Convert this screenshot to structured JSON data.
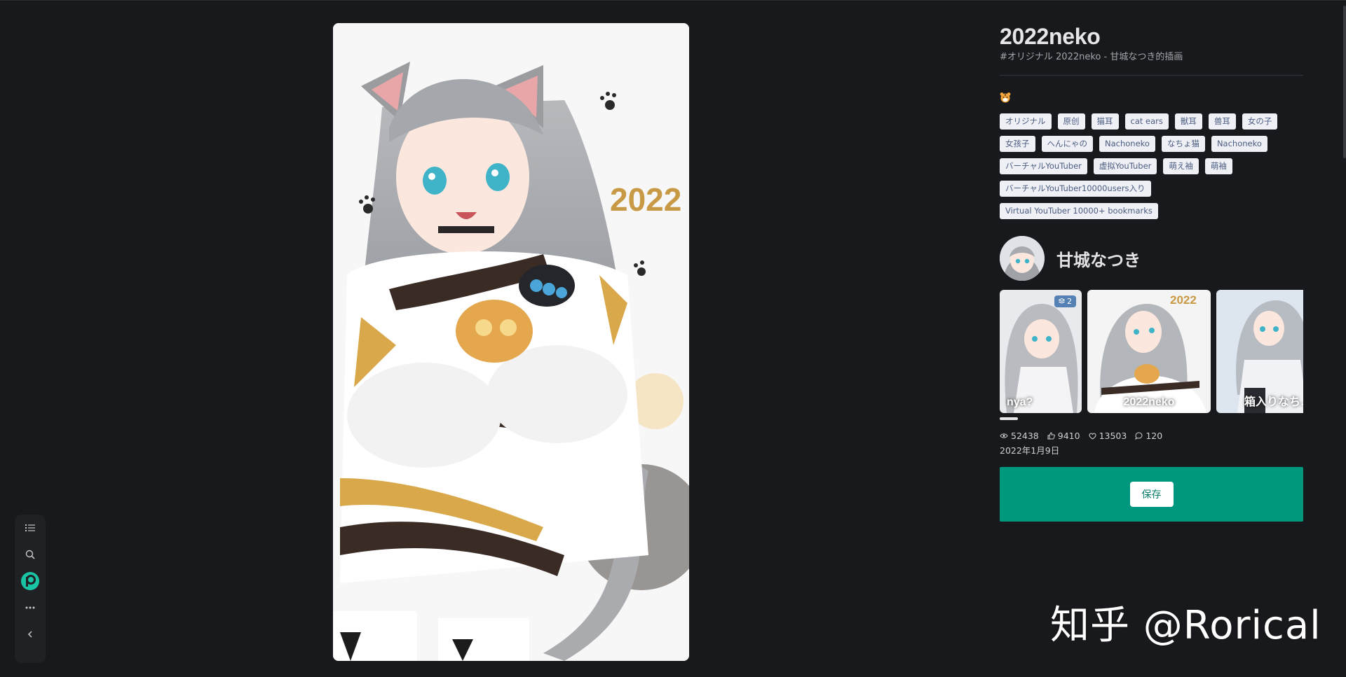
{
  "artwork": {
    "title": "2022neko",
    "subtitle": "#オリジナル 2022neko - 甘城なつき的插画",
    "image_text": "2022"
  },
  "tags": [
    "オリジナル",
    "原创",
    "猫耳",
    "cat ears",
    "獣耳",
    "兽耳",
    "女の子",
    "女孩子",
    "へんにゃの",
    "Nachoneko",
    "なちょ猫",
    "Nachoneko",
    "バーチャルYouTuber",
    "虚拟YouTuber",
    "萌え袖",
    "萌袖",
    "バーチャルYouTuber10000users入り",
    "Virtual YouTuber 10000+ bookmarks"
  ],
  "artist": {
    "name": "甘城なつき"
  },
  "thumbnails": [
    {
      "caption": "nya?",
      "badge": "2"
    },
    {
      "caption": "2022neko",
      "badge": ""
    },
    {
      "caption": "箱入りなち…",
      "badge": ""
    }
  ],
  "stats": {
    "views": "52438",
    "likes": "9410",
    "bookmarks": "13503",
    "comments": "120",
    "date": "2022年1月9日"
  },
  "actions": {
    "save_label": "保存"
  },
  "watermark": "知乎 @Rorical",
  "colors": {
    "background": "#18191c",
    "accent": "#00977f",
    "tag_bg": "#eef0f6",
    "tag_text": "#4b5c80"
  },
  "toolbar": {
    "icons": [
      "list-icon",
      "search-icon",
      "pixiv-logo-icon",
      "more-icon",
      "chevron-left-icon"
    ]
  }
}
